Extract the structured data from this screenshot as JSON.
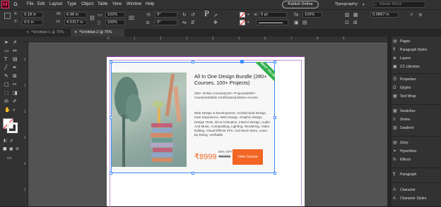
{
  "menubar": {
    "app_icon": "indesign-app-icon",
    "home_icon": "home-icon",
    "items": [
      "File",
      "Edit",
      "Layout",
      "Type",
      "Object",
      "Table",
      "View",
      "Window",
      "Help"
    ],
    "publish_label": "Publish Online",
    "workspace": "Typography",
    "search_placeholder": "Adobe Stock"
  },
  "controlbar": {
    "x_label": "X:",
    "x_value": "0.18 in",
    "y_label": "Y:",
    "y_value": "0.5 in",
    "w_label": "W:",
    "w_value": "6.96 in",
    "h_label": "H:",
    "h_value": "4.5317 in",
    "pct1": "100%",
    "pct2": "100%",
    "angle1": "0°",
    "angle2": "0°",
    "stroke_weight": "0 pt",
    "scale_value": "0.0667 in",
    "stroke_pct": "100%",
    "char_p": "P"
  },
  "tabs": [
    {
      "label": "*Untitled-1 @ 75%"
    },
    {
      "label": "*Untitled-2 @ 75%"
    }
  ],
  "ruler": {
    "top": [
      "0",
      "1",
      "2",
      "3",
      "4",
      "5",
      "6",
      "7",
      "8",
      "9"
    ],
    "left": [
      "0",
      "1",
      "2",
      "3",
      "4",
      "5"
    ]
  },
  "card": {
    "title": "All In One Design Bundle (280+ Courses, 100+ Projects)",
    "subtitle": "280+ Online Courses|100+ Projects|2000+ Hours|Verifiable Certificates|Lifetime Access",
    "description": "Web Design & Development, Architectural Design, User Experience, Web Design, Graphic Design, Design Tools, 3D & Animation, Interior Design, Audio And Music, Compositing, Lighting, Rendering, Video Editing, Visual Effects VFX, And Much More, Learn By Doing, Verifiable",
    "price": "₹8999",
    "discount": "90% OFF",
    "old_price": "₹89999",
    "button": "View Course",
    "ribbon": "BEST VALUE"
  },
  "panels": [
    "Pages",
    "Paragraph Styles",
    "Layers",
    "CC Libraries",
    "Properties",
    "Glyphs",
    "Text Wrap",
    "Swatches",
    "Stroke",
    "Gradient",
    "Story",
    "Hyperlinks",
    "Effects",
    "Paragraph",
    "Character",
    "Character Styles"
  ],
  "colors": {
    "accent": "#f26522",
    "ribbon": "#2eae4a",
    "selection": "#3c8cff"
  }
}
